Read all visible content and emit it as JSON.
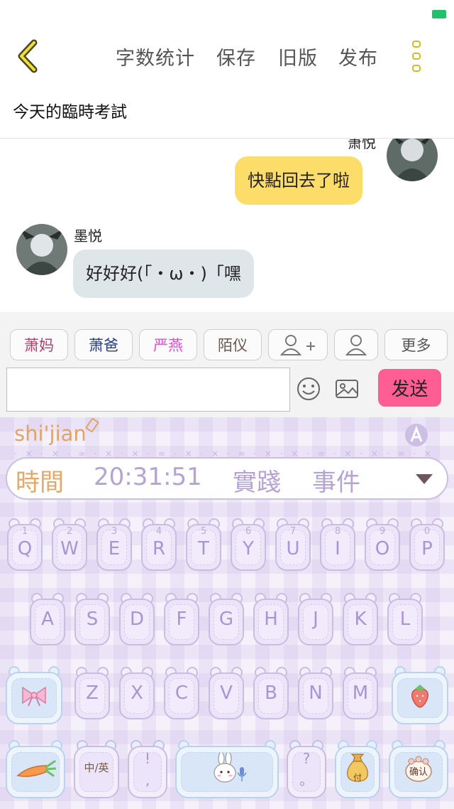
{
  "status": {
    "indicator_color": "#1fc26b"
  },
  "toolbar": {
    "back_icon": "chevron-left-icon",
    "word_count": "字数统计",
    "save": "保存",
    "old_version": "旧版",
    "publish": "发布",
    "more_icon": "more-vertical-icon"
  },
  "document": {
    "title": "今天的臨時考試"
  },
  "chat": {
    "messages": [
      {
        "sender": "萧悦",
        "text": "快點回去了啦",
        "side": "right",
        "bubble_color": "#fddd6a"
      },
      {
        "sender": "墨悦",
        "text": "好好好(「・ω・)「嘿",
        "side": "left",
        "bubble_color": "#dfe6ea"
      }
    ]
  },
  "roles": {
    "chips": [
      {
        "label": "萧妈",
        "color": "#c0396b"
      },
      {
        "label": "萧爸",
        "color": "#23408e"
      },
      {
        "label": "严燕",
        "color": "#e04dd8"
      },
      {
        "label": "陌仪",
        "color": "#6b5a50"
      }
    ],
    "add_role_icon": "add-person-icon",
    "role_icon": "person-icon",
    "more": "更多"
  },
  "composer": {
    "input_value": "",
    "emoji_icon": "smiley-icon",
    "image_icon": "image-icon",
    "send": "发送",
    "send_color": "#ff5e95"
  },
  "keyboard": {
    "pinyin": "shi'jian",
    "logo_icon": "keyboard-logo-icon",
    "candidates": [
      "時間",
      "20:31:51",
      "實踐",
      "事件"
    ],
    "row1": [
      {
        "num": "1",
        "letter": "Q"
      },
      {
        "num": "2",
        "letter": "W"
      },
      {
        "num": "3",
        "letter": "E"
      },
      {
        "num": "4",
        "letter": "R"
      },
      {
        "num": "5",
        "letter": "T"
      },
      {
        "num": "6",
        "letter": "Y"
      },
      {
        "num": "7",
        "letter": "U"
      },
      {
        "num": "8",
        "letter": "I"
      },
      {
        "num": "9",
        "letter": "O"
      },
      {
        "num": "0",
        "letter": "P"
      }
    ],
    "row2": [
      "A",
      "S",
      "D",
      "F",
      "G",
      "H",
      "J",
      "K",
      "L"
    ],
    "row3": [
      "Z",
      "X",
      "C",
      "V",
      "B",
      "N",
      "M"
    ],
    "zh_en_label": "中/英",
    "punct_top": "!",
    "punct_bottom": ",",
    "question_top": "?",
    "question_bottom": "。",
    "enter_label": "确认",
    "pay_label": "付"
  }
}
